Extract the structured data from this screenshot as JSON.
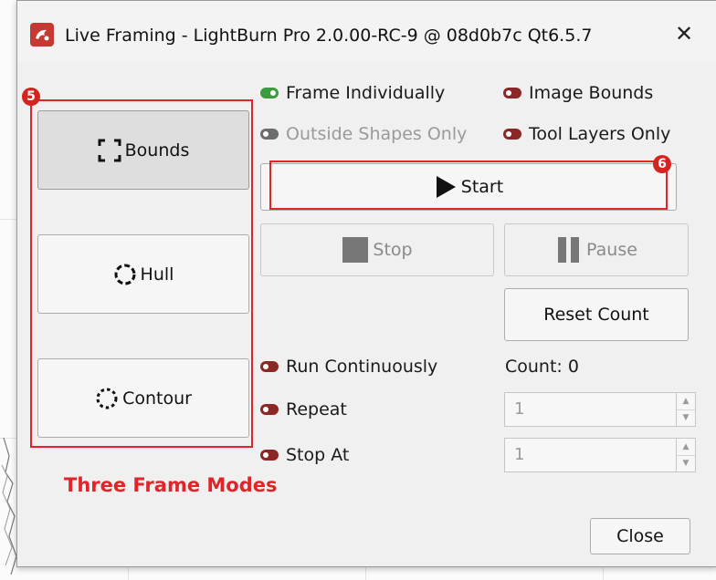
{
  "window": {
    "title": "Live Framing - LightBurn Pro 2.0.00-RC-9 @ 08d0b7c Qt6.5.7",
    "close_glyph": "✕"
  },
  "frame_modes": [
    {
      "label": "Bounds",
      "icon": "bounds-icon",
      "pressed": true
    },
    {
      "label": "Hull",
      "icon": "hull-icon",
      "pressed": false
    },
    {
      "label": "Contour",
      "icon": "contour-icon",
      "pressed": false
    }
  ],
  "options": {
    "frame_individually": {
      "label": "Frame Individually",
      "state": "on"
    },
    "image_bounds": {
      "label": "Image Bounds",
      "state": "off"
    },
    "outside_shapes_only": {
      "label": "Outside Shapes Only",
      "state": "disabled"
    },
    "tool_layers_only": {
      "label": "Tool Layers Only",
      "state": "off"
    }
  },
  "controls": {
    "start_label": "Start",
    "stop_label": "Stop",
    "pause_label": "Pause",
    "reset_label": "Reset Count"
  },
  "run": {
    "run_continuously": {
      "label": "Run Continuously",
      "state": "off"
    },
    "repeat": {
      "label": "Repeat",
      "state": "off"
    },
    "stop_at": {
      "label": "Stop At",
      "state": "off"
    },
    "count_label": "Count: 0",
    "repeat_value": "1",
    "stop_at_value": "1"
  },
  "footer": {
    "close_label": "Close"
  },
  "annotations": {
    "badge_modes": "5",
    "badge_start": "6",
    "modes_caption": "Three Frame Modes"
  },
  "colors": {
    "annotation_red": "#e0242a",
    "toggle_on": "#3d9b3f",
    "toggle_off": "#8b2727",
    "toggle_disabled": "#6d6d6d"
  }
}
